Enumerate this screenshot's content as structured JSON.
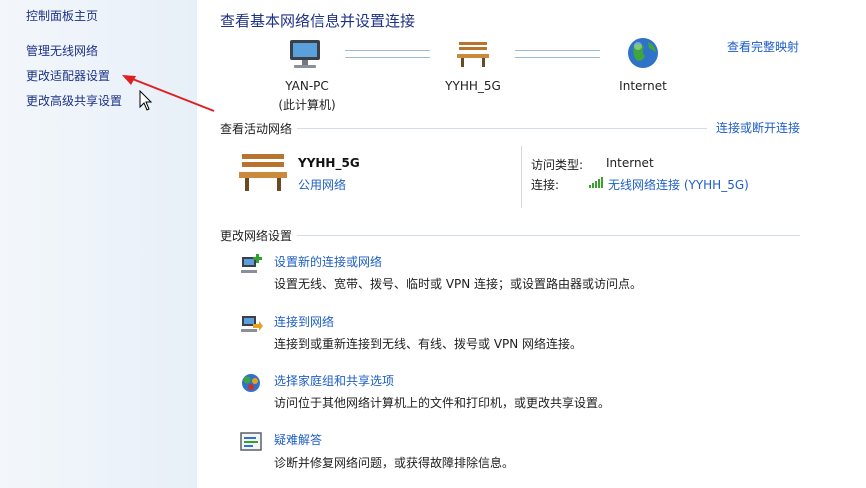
{
  "sidebar": {
    "items": [
      {
        "label": "控制面板主页"
      },
      {
        "label": "管理无线网络"
      },
      {
        "label": "更改适配器设置"
      },
      {
        "label": "更改高级共享设置"
      }
    ]
  },
  "main": {
    "title": "查看基本网络信息并设置连接",
    "view_full_map": "查看完整映射",
    "network_map": {
      "nodes": [
        {
          "label": "YAN-PC",
          "sublabel": "(此计算机)",
          "icon": "computer-icon"
        },
        {
          "label": "YYHH_5G",
          "icon": "bench-icon"
        },
        {
          "label": "Internet",
          "icon": "globe-icon"
        }
      ]
    },
    "active_networks": {
      "heading": "查看活动网络",
      "action_link": "连接或断开连接",
      "network_name": "YYHH_5G",
      "network_type": "公用网络",
      "access_type_label": "访问类型:",
      "access_type_value": "Internet",
      "connection_label": "连接:",
      "connection_value": "无线网络连接 (YYHH_5G)"
    },
    "change_settings": {
      "heading": "更改网络设置",
      "tasks": [
        {
          "title": "设置新的连接或网络",
          "description": "设置无线、宽带、拨号、临时或 VPN 连接；或设置路由器或访问点。",
          "icon": "new-connection-icon"
        },
        {
          "title": "连接到网络",
          "description": "连接到或重新连接到无线、有线、拨号或 VPN 网络连接。",
          "icon": "connect-network-icon"
        },
        {
          "title": "选择家庭组和共享选项",
          "description": "访问位于其他网络计算机上的文件和打印机，或更改共享设置。",
          "icon": "homegroup-icon"
        },
        {
          "title": "疑难解答",
          "description": "诊断并修复网络问题，或获得故障排除信息。",
          "icon": "troubleshoot-icon"
        }
      ]
    }
  },
  "colors": {
    "link": "#1e5ec8",
    "title": "#1e3287",
    "annotation_arrow": "#e02020",
    "sidebar_bg": "#e7eff8"
  }
}
